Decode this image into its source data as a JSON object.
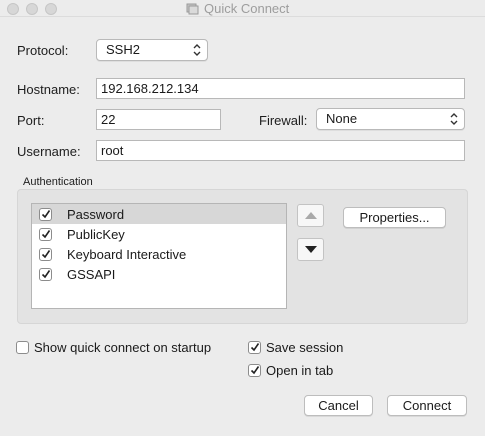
{
  "window": {
    "title": "Quick Connect"
  },
  "protocol": {
    "label": "Protocol:",
    "value": "SSH2"
  },
  "hostname": {
    "label": "Hostname:",
    "value": "192.168.212.134"
  },
  "port": {
    "label": "Port:",
    "value": "22"
  },
  "firewall": {
    "label": "Firewall:",
    "value": "None"
  },
  "username": {
    "label": "Username:",
    "value": "root"
  },
  "authentication": {
    "label": "Authentication",
    "methods": [
      {
        "label": "Password",
        "checked": true,
        "selected": true
      },
      {
        "label": "PublicKey",
        "checked": true,
        "selected": false
      },
      {
        "label": "Keyboard Interactive",
        "checked": true,
        "selected": false
      },
      {
        "label": "GSSAPI",
        "checked": true,
        "selected": false
      }
    ],
    "properties_label": "Properties..."
  },
  "options": {
    "show_on_startup": {
      "label": "Show quick connect on startup",
      "checked": false
    },
    "save_session": {
      "label": "Save session",
      "checked": true
    },
    "open_in_tab": {
      "label": "Open in tab",
      "checked": true
    }
  },
  "buttons": {
    "cancel": "Cancel",
    "connect": "Connect"
  }
}
